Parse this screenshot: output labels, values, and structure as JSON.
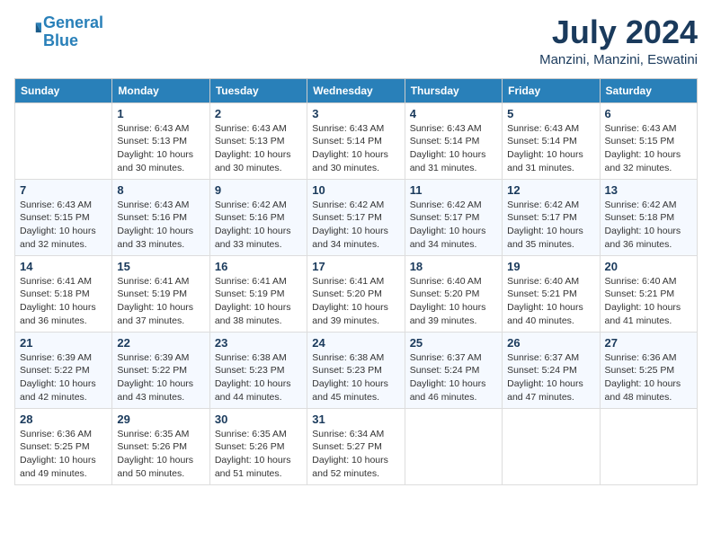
{
  "header": {
    "logo_line1": "General",
    "logo_line2": "Blue",
    "month_year": "July 2024",
    "location": "Manzini, Manzini, Eswatini"
  },
  "days_of_week": [
    "Sunday",
    "Monday",
    "Tuesday",
    "Wednesday",
    "Thursday",
    "Friday",
    "Saturday"
  ],
  "weeks": [
    [
      {
        "day": "",
        "sunrise": "",
        "sunset": "",
        "daylight": ""
      },
      {
        "day": "1",
        "sunrise": "Sunrise: 6:43 AM",
        "sunset": "Sunset: 5:13 PM",
        "daylight": "Daylight: 10 hours and 30 minutes."
      },
      {
        "day": "2",
        "sunrise": "Sunrise: 6:43 AM",
        "sunset": "Sunset: 5:13 PM",
        "daylight": "Daylight: 10 hours and 30 minutes."
      },
      {
        "day": "3",
        "sunrise": "Sunrise: 6:43 AM",
        "sunset": "Sunset: 5:14 PM",
        "daylight": "Daylight: 10 hours and 30 minutes."
      },
      {
        "day": "4",
        "sunrise": "Sunrise: 6:43 AM",
        "sunset": "Sunset: 5:14 PM",
        "daylight": "Daylight: 10 hours and 31 minutes."
      },
      {
        "day": "5",
        "sunrise": "Sunrise: 6:43 AM",
        "sunset": "Sunset: 5:14 PM",
        "daylight": "Daylight: 10 hours and 31 minutes."
      },
      {
        "day": "6",
        "sunrise": "Sunrise: 6:43 AM",
        "sunset": "Sunset: 5:15 PM",
        "daylight": "Daylight: 10 hours and 32 minutes."
      }
    ],
    [
      {
        "day": "7",
        "sunrise": "Sunrise: 6:43 AM",
        "sunset": "Sunset: 5:15 PM",
        "daylight": "Daylight: 10 hours and 32 minutes."
      },
      {
        "day": "8",
        "sunrise": "Sunrise: 6:43 AM",
        "sunset": "Sunset: 5:16 PM",
        "daylight": "Daylight: 10 hours and 33 minutes."
      },
      {
        "day": "9",
        "sunrise": "Sunrise: 6:42 AM",
        "sunset": "Sunset: 5:16 PM",
        "daylight": "Daylight: 10 hours and 33 minutes."
      },
      {
        "day": "10",
        "sunrise": "Sunrise: 6:42 AM",
        "sunset": "Sunset: 5:17 PM",
        "daylight": "Daylight: 10 hours and 34 minutes."
      },
      {
        "day": "11",
        "sunrise": "Sunrise: 6:42 AM",
        "sunset": "Sunset: 5:17 PM",
        "daylight": "Daylight: 10 hours and 34 minutes."
      },
      {
        "day": "12",
        "sunrise": "Sunrise: 6:42 AM",
        "sunset": "Sunset: 5:17 PM",
        "daylight": "Daylight: 10 hours and 35 minutes."
      },
      {
        "day": "13",
        "sunrise": "Sunrise: 6:42 AM",
        "sunset": "Sunset: 5:18 PM",
        "daylight": "Daylight: 10 hours and 36 minutes."
      }
    ],
    [
      {
        "day": "14",
        "sunrise": "Sunrise: 6:41 AM",
        "sunset": "Sunset: 5:18 PM",
        "daylight": "Daylight: 10 hours and 36 minutes."
      },
      {
        "day": "15",
        "sunrise": "Sunrise: 6:41 AM",
        "sunset": "Sunset: 5:19 PM",
        "daylight": "Daylight: 10 hours and 37 minutes."
      },
      {
        "day": "16",
        "sunrise": "Sunrise: 6:41 AM",
        "sunset": "Sunset: 5:19 PM",
        "daylight": "Daylight: 10 hours and 38 minutes."
      },
      {
        "day": "17",
        "sunrise": "Sunrise: 6:41 AM",
        "sunset": "Sunset: 5:20 PM",
        "daylight": "Daylight: 10 hours and 39 minutes."
      },
      {
        "day": "18",
        "sunrise": "Sunrise: 6:40 AM",
        "sunset": "Sunset: 5:20 PM",
        "daylight": "Daylight: 10 hours and 39 minutes."
      },
      {
        "day": "19",
        "sunrise": "Sunrise: 6:40 AM",
        "sunset": "Sunset: 5:21 PM",
        "daylight": "Daylight: 10 hours and 40 minutes."
      },
      {
        "day": "20",
        "sunrise": "Sunrise: 6:40 AM",
        "sunset": "Sunset: 5:21 PM",
        "daylight": "Daylight: 10 hours and 41 minutes."
      }
    ],
    [
      {
        "day": "21",
        "sunrise": "Sunrise: 6:39 AM",
        "sunset": "Sunset: 5:22 PM",
        "daylight": "Daylight: 10 hours and 42 minutes."
      },
      {
        "day": "22",
        "sunrise": "Sunrise: 6:39 AM",
        "sunset": "Sunset: 5:22 PM",
        "daylight": "Daylight: 10 hours and 43 minutes."
      },
      {
        "day": "23",
        "sunrise": "Sunrise: 6:38 AM",
        "sunset": "Sunset: 5:23 PM",
        "daylight": "Daylight: 10 hours and 44 minutes."
      },
      {
        "day": "24",
        "sunrise": "Sunrise: 6:38 AM",
        "sunset": "Sunset: 5:23 PM",
        "daylight": "Daylight: 10 hours and 45 minutes."
      },
      {
        "day": "25",
        "sunrise": "Sunrise: 6:37 AM",
        "sunset": "Sunset: 5:24 PM",
        "daylight": "Daylight: 10 hours and 46 minutes."
      },
      {
        "day": "26",
        "sunrise": "Sunrise: 6:37 AM",
        "sunset": "Sunset: 5:24 PM",
        "daylight": "Daylight: 10 hours and 47 minutes."
      },
      {
        "day": "27",
        "sunrise": "Sunrise: 6:36 AM",
        "sunset": "Sunset: 5:25 PM",
        "daylight": "Daylight: 10 hours and 48 minutes."
      }
    ],
    [
      {
        "day": "28",
        "sunrise": "Sunrise: 6:36 AM",
        "sunset": "Sunset: 5:25 PM",
        "daylight": "Daylight: 10 hours and 49 minutes."
      },
      {
        "day": "29",
        "sunrise": "Sunrise: 6:35 AM",
        "sunset": "Sunset: 5:26 PM",
        "daylight": "Daylight: 10 hours and 50 minutes."
      },
      {
        "day": "30",
        "sunrise": "Sunrise: 6:35 AM",
        "sunset": "Sunset: 5:26 PM",
        "daylight": "Daylight: 10 hours and 51 minutes."
      },
      {
        "day": "31",
        "sunrise": "Sunrise: 6:34 AM",
        "sunset": "Sunset: 5:27 PM",
        "daylight": "Daylight: 10 hours and 52 minutes."
      },
      {
        "day": "",
        "sunrise": "",
        "sunset": "",
        "daylight": ""
      },
      {
        "day": "",
        "sunrise": "",
        "sunset": "",
        "daylight": ""
      },
      {
        "day": "",
        "sunrise": "",
        "sunset": "",
        "daylight": ""
      }
    ]
  ]
}
